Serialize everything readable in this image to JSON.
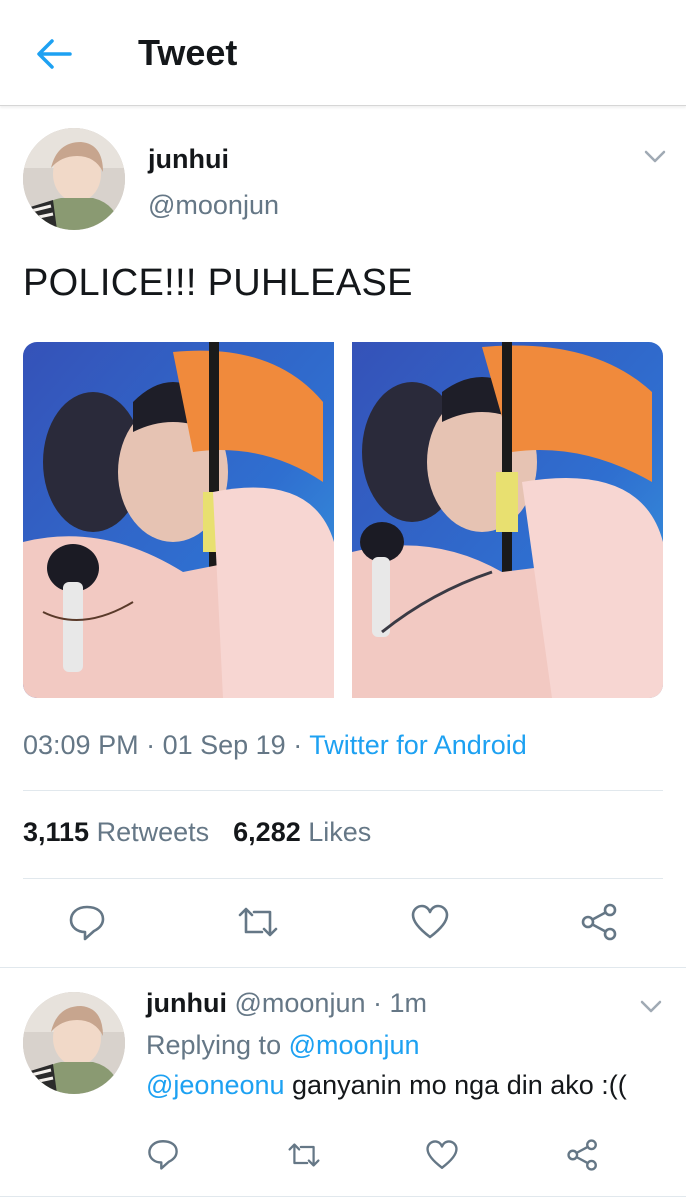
{
  "header": {
    "title": "Tweet",
    "back_icon": "back-arrow-icon"
  },
  "tweet": {
    "display_name": "junhui",
    "handle": "@moonjun",
    "text": "POLICE!!! PUHLEASE",
    "time": "03:09 PM",
    "sep1": " · ",
    "date": "01 Sep 19",
    "sep2": " · ",
    "source": "Twitter for Android",
    "retweets_count": "3,115",
    "retweets_label": "Retweets",
    "likes_count": "6,282",
    "likes_label": "Likes",
    "media_count": 2
  },
  "reply": {
    "display_name": "junhui",
    "handle": "@moonjun",
    "sep": " · ",
    "age": "1m",
    "replying_prefix": "Replying to ",
    "replying_to": "@moonjun",
    "mention": "@jeoneonu",
    "text": " ganyanin mo nga din ako :(("
  },
  "actions": [
    "reply-icon",
    "retweet-icon",
    "like-icon",
    "share-icon"
  ],
  "colors": {
    "accent": "#1da1f2",
    "secondary_text": "#657786",
    "primary_text": "#14171a",
    "divider": "#e1e8ed"
  }
}
